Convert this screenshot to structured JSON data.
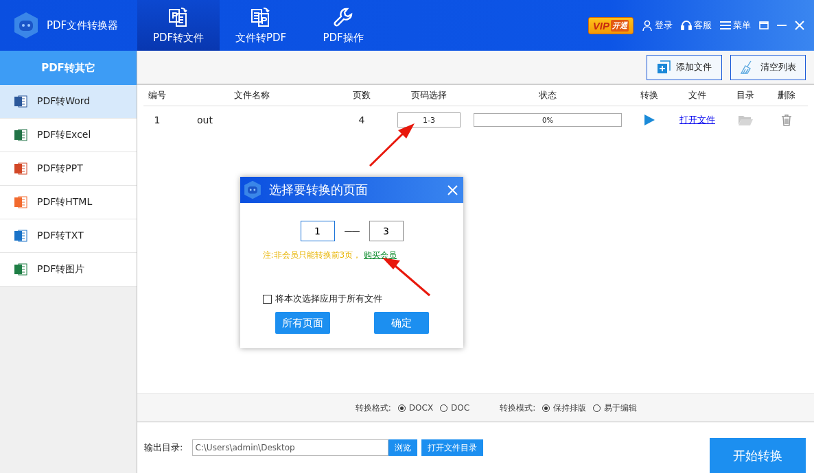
{
  "app": {
    "title": "PDF文件转换器"
  },
  "tabs": [
    {
      "label": "PDF转文件",
      "selected": true
    },
    {
      "label": "文件转PDF",
      "selected": false
    },
    {
      "label": "PDF操作",
      "selected": false
    }
  ],
  "vip_badge": {
    "label": "VIP",
    "suffix": "开通"
  },
  "header_actions": [
    {
      "label": "登录"
    },
    {
      "label": "客服"
    },
    {
      "label": "菜单"
    }
  ],
  "sidebar": {
    "title": "PDF转其它",
    "items": [
      {
        "label": "PDF转Word",
        "color": "#2b579a",
        "selected": true
      },
      {
        "label": "PDF转Excel",
        "color": "#217346",
        "selected": false
      },
      {
        "label": "PDF转PPT",
        "color": "#d24726",
        "selected": false
      },
      {
        "label": "PDF转HTML",
        "color": "#f26a2e",
        "selected": false
      },
      {
        "label": "PDF转TXT",
        "color": "#1a73c8",
        "selected": false
      },
      {
        "label": "PDF转图片",
        "color": "#1e7e45",
        "selected": false
      }
    ]
  },
  "toolbar": [
    {
      "label": "添加文件"
    },
    {
      "label": "清空列表"
    }
  ],
  "table": {
    "columns": [
      "编号",
      "文件名称",
      "页数",
      "页码选择",
      "状态",
      "转换",
      "文件",
      "目录",
      "删除"
    ],
    "rows": [
      {
        "index": "1",
        "name": "out",
        "pages": "4",
        "page_range": "1-3",
        "status": "0%",
        "level": 0,
        "open_file": "打开文件"
      }
    ]
  },
  "dialog": {
    "title": "选择要转换的页面",
    "from": "1",
    "separator": "——",
    "to": "3",
    "note": "注:非会员只能转换前3页，",
    "link": "购买会员",
    "apply_all": {
      "label": "将本次选择应用于所有文件",
      "checked": false
    },
    "buttons": [
      "所有页面",
      "确定"
    ]
  },
  "options": [
    {
      "label": "转换格式:",
      "choices": [
        {
          "label": "DOCX",
          "selected": true
        },
        {
          "label": "DOC",
          "selected": false
        }
      ]
    },
    {
      "label": "转换模式:",
      "choices": [
        {
          "label": "保持排版",
          "selected": true
        },
        {
          "label": "易于编辑",
          "selected": false
        }
      ]
    }
  ],
  "output": {
    "label": "输出目录:",
    "path": "C:\\Users\\admin\\Desktop",
    "browse": "浏览",
    "open_dir": "打开文件目录"
  },
  "start_button": "开始转换"
}
